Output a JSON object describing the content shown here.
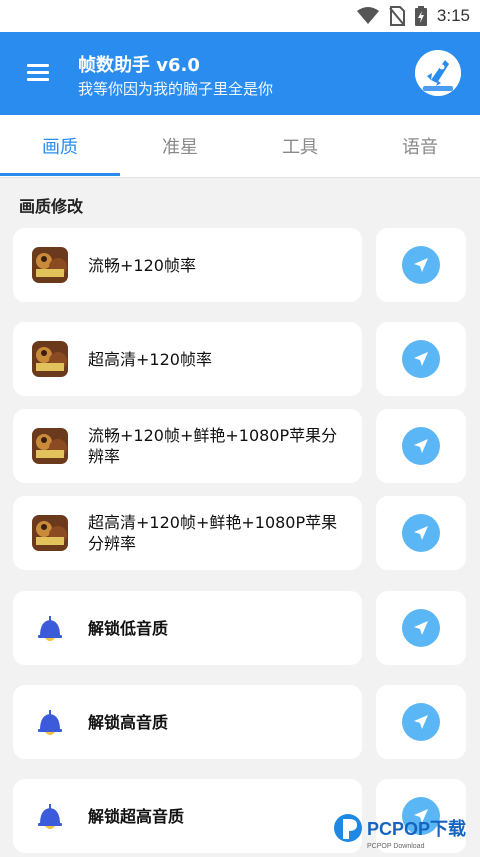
{
  "status_bar": {
    "time": "3:15",
    "icons": [
      "wifi-icon",
      "no-sim-icon",
      "battery-charging-icon"
    ]
  },
  "app_bar": {
    "title": "帧数助手 v6.0",
    "subtitle": "我等你因为我的脑子里全是你",
    "logo_text": "帧数助手"
  },
  "tabs": [
    {
      "label": "画质",
      "active": true
    },
    {
      "label": "准星",
      "active": false
    },
    {
      "label": "工具",
      "active": false
    },
    {
      "label": "语音",
      "active": false
    }
  ],
  "section": {
    "title": "画质修改"
  },
  "rows": [
    {
      "label": "流畅+120帧率",
      "icon": "game-avatar-icon"
    },
    {
      "label": "超高清+120帧率",
      "icon": "game-avatar-icon"
    },
    {
      "label": "流畅+120帧+鲜艳+1080P苹果分辨率",
      "icon": "game-avatar-icon"
    },
    {
      "label": "超高清+120帧+鲜艳+1080P苹果分辨率",
      "icon": "game-avatar-icon"
    },
    {
      "label": "解锁低音质",
      "icon": "bell-icon"
    },
    {
      "label": "解锁高音质",
      "icon": "bell-icon"
    },
    {
      "label": "解锁超高音质",
      "icon": "bell-icon"
    }
  ],
  "watermark": {
    "text": "PCPOP下载",
    "subtext": "PCPOP Download"
  },
  "colors": {
    "primary": "#2b8cf0",
    "send_button": "#5ab6f5",
    "background": "#f2f2f2",
    "bell": "#3b5bdb",
    "bell_base": "#f4c13d"
  }
}
